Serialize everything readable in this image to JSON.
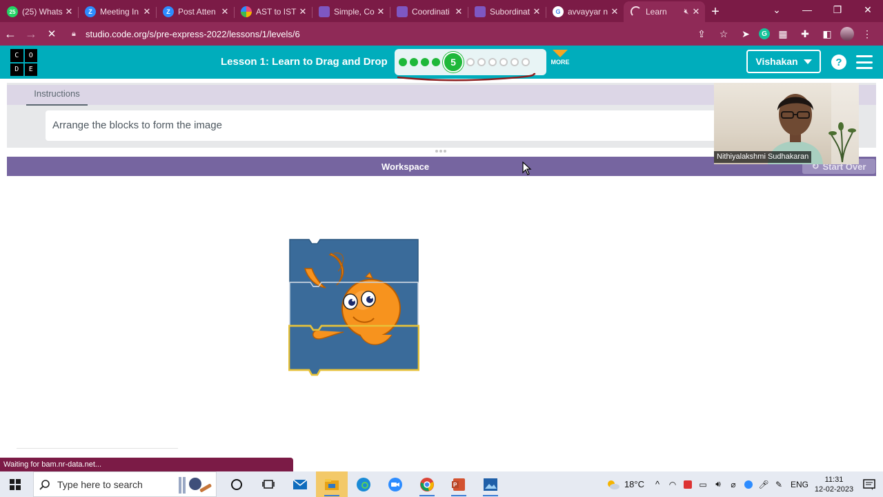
{
  "browser": {
    "tabs": [
      {
        "label": "(25) Whats",
        "favicon": "whatsapp-icon",
        "color": "#25d366",
        "glyph": "25",
        "active": false
      },
      {
        "label": "Meeting In",
        "favicon": "zoom-icon",
        "color": "#2d8cff",
        "glyph": "Z",
        "active": false
      },
      {
        "label": "Post Atten",
        "favicon": "zoom-icon",
        "color": "#2d8cff",
        "glyph": "Z",
        "active": false
      },
      {
        "label": "AST to IST",
        "favicon": "timezone-icon",
        "color": "#e94b7a",
        "glyph": "◕",
        "active": false
      },
      {
        "label": "Simple, Co",
        "favicon": "page-icon",
        "color": "#7e57c2",
        "glyph": "▢",
        "active": false
      },
      {
        "label": "Coordinati",
        "favicon": "page-icon",
        "color": "#7e57c2",
        "glyph": "▢",
        "active": false
      },
      {
        "label": "Subordinat",
        "favicon": "page-icon",
        "color": "#7e57c2",
        "glyph": "▢",
        "active": false
      },
      {
        "label": "avvayyar n",
        "favicon": "google-icon",
        "color": "#ffffff",
        "glyph": "G",
        "active": false
      },
      {
        "label": "Learn",
        "favicon": "loading-icon",
        "color": "#8f2a57",
        "glyph": "◜",
        "active": true
      }
    ],
    "url": "studio.code.org/s/pre-express-2022/lessons/1/levels/6",
    "status_text": "Waiting for bam.nr-data.net..."
  },
  "header": {
    "logo_letters": [
      "C",
      "O",
      "D",
      "E"
    ],
    "lesson_title": "Lesson 1: Learn to Drag and Drop",
    "current_level": "5",
    "completed_levels": 4,
    "total_levels": 11,
    "more_label": "MORE",
    "user_name": "Vishakan",
    "help_label": "?",
    "colors": {
      "header_bg": "#00adbc",
      "progress_done": "#1fb83a",
      "more_arrow": "#f5a623"
    }
  },
  "instructions": {
    "tab_label": "Instructions",
    "text": "Arrange the blocks to form the image"
  },
  "workspace": {
    "title": "Workspace",
    "start_over_label": "Start Over",
    "header_color": "#7665a0"
  },
  "webcam": {
    "participant_name": "Nithiyalakshmi Sudhakaran"
  },
  "taskbar": {
    "search_placeholder": "Type here to search",
    "weather": "18°C",
    "language": "ENG",
    "time": "11:31",
    "date": "12-02-2023",
    "apps": [
      "cortana-icon",
      "task-view-icon",
      "mail-icon",
      "file-explorer-icon",
      "edge-icon",
      "zoom-icon",
      "chrome-icon",
      "powerpoint-icon",
      "photos-icon"
    ]
  }
}
